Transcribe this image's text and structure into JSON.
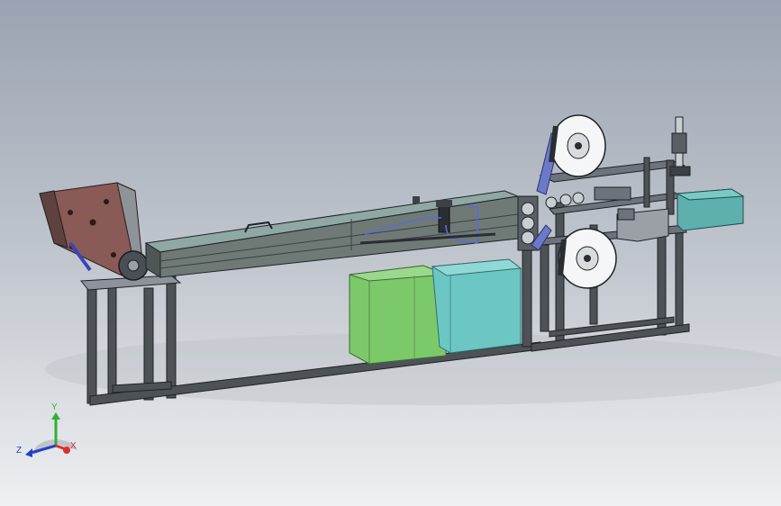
{
  "viewport": {
    "background_top": "#9aa3b1",
    "background_bottom": "#eef0f2"
  },
  "model": {
    "components": [
      "frame",
      "feed-hopper",
      "conveyor",
      "sealing-head",
      "green-bin",
      "teal-bin",
      "upper-film-roll",
      "lower-film-roll",
      "control-box",
      "output-tray",
      "guide-rollers",
      "film-belt"
    ],
    "colors": {
      "frame": "#4d5257",
      "frame_edge": "#1e2226",
      "hopper_plate": "#8a5a57",
      "conveyor": "#6f7a77",
      "conveyor_glass": "#8fa8a3",
      "green_bin": "#7cc96a",
      "teal_bin": "#6cc7c4",
      "film_roll": "#f5f6f7",
      "film_belt": "#6c78c8",
      "output_tray": "#5db0ad",
      "control_box": "#9aa0a5",
      "wire": "#5a6bd8"
    }
  },
  "triad": {
    "x_label": "X",
    "y_label": "Y",
    "z_label": "Z",
    "x_color": "#d83030",
    "y_color": "#30b030",
    "z_color": "#2a3fc8"
  }
}
